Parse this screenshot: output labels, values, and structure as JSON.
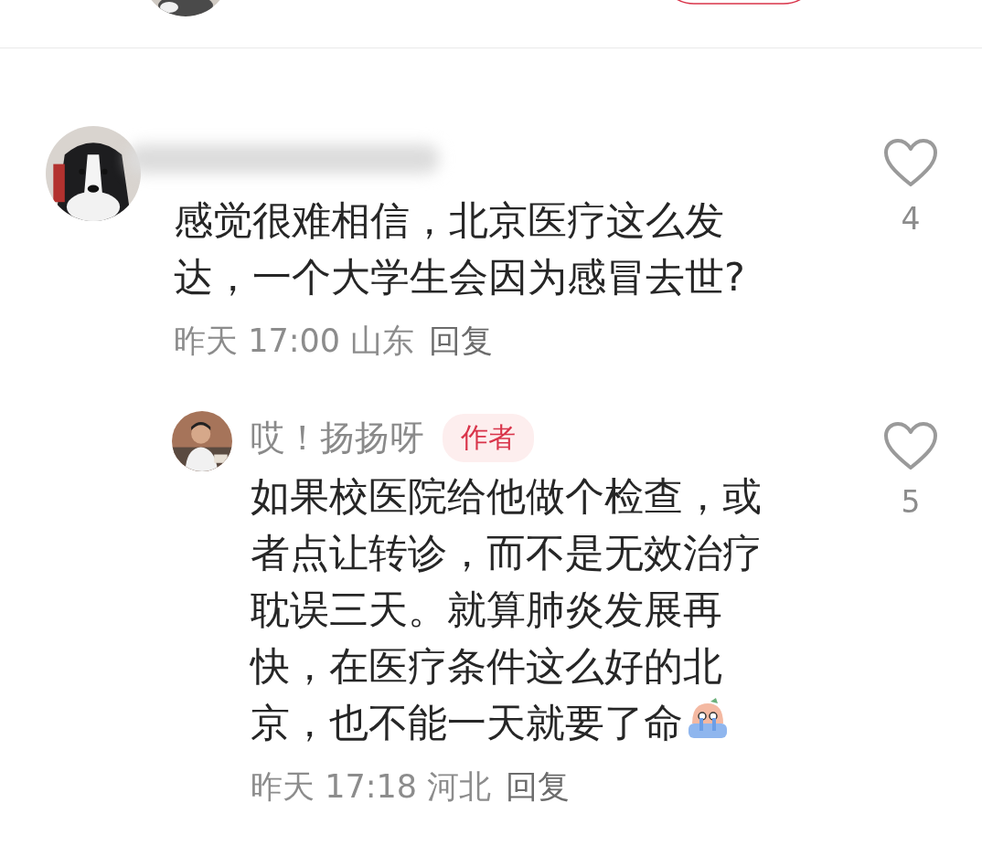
{
  "comments": [
    {
      "text": "感觉很难相信，北京医疗这么发达，一个大学生会因为感冒去世?",
      "time": "昨天 17:00",
      "location": "山东",
      "reply_label": "回复",
      "likes": "4",
      "replies": [
        {
          "author": "哎！扬扬呀",
          "badge": "作者",
          "text": "如果校医院给他做个检查，或者点让转诊，而不是无效治疗耽误三天。就算肺炎发展再快，在医疗条件这么好的北京，也不能一天就要了命",
          "time": "昨天 17:18",
          "location": "河北",
          "reply_label": "回复",
          "likes": "5"
        }
      ]
    }
  ]
}
